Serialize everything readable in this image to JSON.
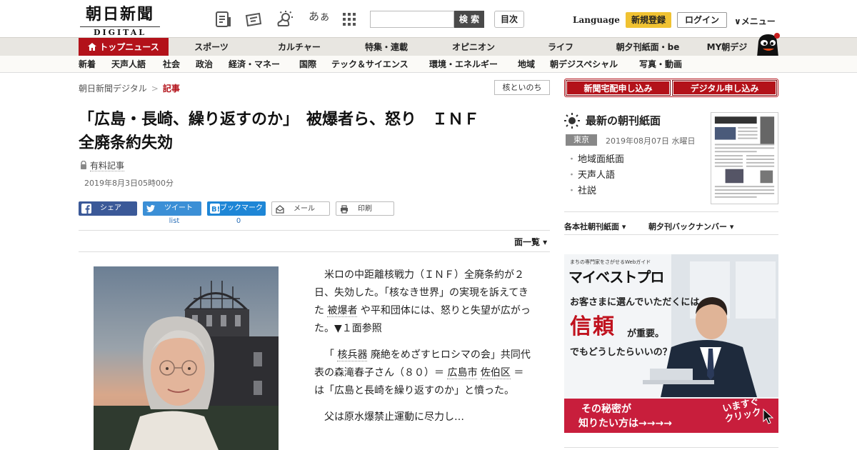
{
  "header": {
    "logo_jp": "朝日新聞",
    "logo_en": "DIGITAL",
    "aa_label": "あぁ",
    "search_placeholder": "",
    "search_button": "検 索",
    "toc_button": "目次",
    "language": "Language",
    "signup": "新規登録",
    "login": "ログイン",
    "menu": "∨メニュー"
  },
  "nav_main": [
    "トップニュース",
    "スポーツ",
    "カルチャー",
    "特集・連載",
    "オピニオン",
    "ライフ",
    "朝夕刊紙面・be",
    "MY朝デジ"
  ],
  "nav_sub": [
    "新着",
    "天声人語",
    "社会",
    "政治",
    "経済・マネー",
    "国際",
    "テック＆サイエンス",
    "環境・エネルギー",
    "地域",
    "朝デジスペシャル",
    "写真・動画"
  ],
  "breadcrumb": {
    "home": "朝日新聞デジタル",
    "sep": ">",
    "current": "記事"
  },
  "tag_button": "核といのち",
  "article": {
    "headline_line1": "「広島・長崎、繰り返すのか」　被爆者ら、怒り　ＩＮＦ",
    "headline_line2": "全廃条約失効",
    "paid_label": "有料記事",
    "date": "2019年8月3日05時00分",
    "p1": "米ロの中距離核戦力（ＩＮＦ）全廃条約が２日、失効した。「核なき世界」の実現を訴えてきた",
    "p1_link": "被爆者",
    "p1_rest": "や平和団体には、怒りと失望が広がった。▼１面参照",
    "p2_a": "「",
    "p2_link1": "核兵器",
    "p2_b": "廃絶をめざすヒロシマの会」共同代表の森滝春子さん（８０）＝",
    "p2_link2": "広島市",
    "p2_link3": "佐伯区",
    "p2_c": "＝は「広島と長崎を繰り返すのか」と憤った。",
    "p3": "父は原水爆禁止運動に尽力し…"
  },
  "share": {
    "facebook": "シェア",
    "twitter": "ツイート",
    "hatena": "ブックマーク",
    "mail": "メール",
    "print": "印刷",
    "twitter_count": "list",
    "hatena_count": "0"
  },
  "men_list": "面一覧 ▾",
  "sidebar": {
    "subscribe_paper": "新聞宅配申し込み",
    "subscribe_digital": "デジタル申し込み",
    "morning_title": "最新の朝刊紙面",
    "location": "東京",
    "paper_date": "2019年08月07日 水曜日",
    "paper_links": [
      "地域面紙面",
      "天声人語",
      "社説"
    ],
    "back_number1": "各本社朝刊紙面 ▾",
    "back_number2": "朝夕刊バックナンバー ▾"
  },
  "ad": {
    "top_text": "まちの専門家をさがせるWebガイド",
    "brand": "マイベストプロ",
    "line1": "お客さまに選んでいただくには",
    "big": "信頼",
    "small": "が重要。",
    "line3": "でもどうしたらいいの？",
    "band1": "その秘密が",
    "band2": "知りたい方は→→→→",
    "click": "いますぐ クリック"
  },
  "colors": {
    "brand_red": "#b3121a",
    "signup_yellow": "#f0c232",
    "facebook": "#3b5998",
    "twitter": "#3b8fd6"
  }
}
